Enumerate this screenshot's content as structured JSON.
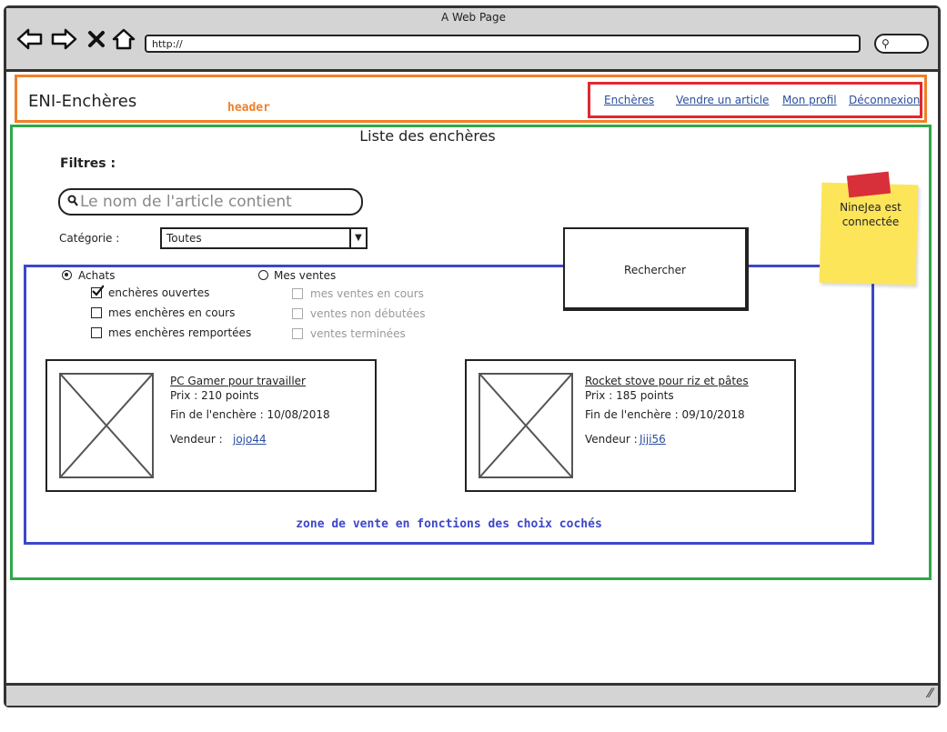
{
  "window": {
    "title": "A Web Page",
    "url": "http://",
    "icons": [
      "back-arrow-icon",
      "forward-arrow-icon",
      "close-icon",
      "home-icon",
      "search-icon"
    ]
  },
  "header": {
    "site_title": "ENI-Enchères",
    "annotation": "header",
    "nav": {
      "encheres": "Enchères",
      "vendre": "Vendre un article",
      "profil": "Mon profil",
      "deconnexion": "Déconnexion"
    }
  },
  "main": {
    "title": "Liste des enchères",
    "filters_label": "Filtres :",
    "search": {
      "placeholder": "Le nom de l'article contient",
      "value": ""
    },
    "category": {
      "label": "Catégorie :",
      "selected": "Toutes"
    },
    "search_button": "Rechercher",
    "sticky_note": {
      "line1": "NineJea est",
      "line2": "connectée"
    },
    "purchases": {
      "label": "Achats",
      "selected": true,
      "options": [
        {
          "label": "enchères ouvertes",
          "checked": true
        },
        {
          "label": "mes enchères en cours",
          "checked": false
        },
        {
          "label": "mes enchères remportées",
          "checked": false
        }
      ]
    },
    "sales": {
      "label": "Mes ventes",
      "selected": false,
      "options": [
        {
          "label": "mes ventes en cours",
          "checked": false,
          "disabled": true
        },
        {
          "label": "ventes non débutées",
          "checked": false,
          "disabled": true
        },
        {
          "label": "ventes terminées",
          "checked": false,
          "disabled": true
        }
      ]
    },
    "cards": [
      {
        "title": "PC Gamer pour travailler",
        "price": "Prix : 210 points",
        "end": "Fin de l'enchère : 10/08/2018",
        "seller_label": "Vendeur :",
        "seller": "jojo44"
      },
      {
        "title": "Rocket stove pour riz et pâtes",
        "price": "Prix : 185 points",
        "end": "Fin de l'enchère : 09/10/2018",
        "seller_label": "Vendeur :",
        "seller": "Jiji56"
      }
    ],
    "zone_annotation": "zone de vente en fonctions des choix cochés"
  },
  "colors": {
    "header_box": "#f07f2a",
    "nav_box": "#e3282d",
    "main_box": "#2ea84a",
    "zone_box": "#3c47c8",
    "link": "#2a4f9e",
    "sticky": "#fde55a"
  }
}
